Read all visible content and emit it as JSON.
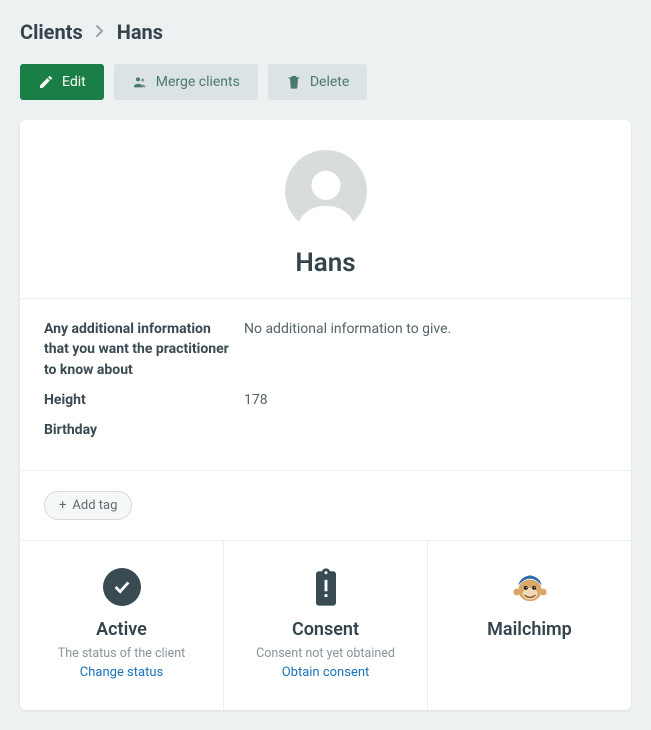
{
  "breadcrumb": {
    "root": "Clients",
    "current": "Hans"
  },
  "actions": {
    "edit": "Edit",
    "merge": "Merge clients",
    "delete": "Delete"
  },
  "profile": {
    "name": "Hans",
    "fields": [
      {
        "label": "Any additional information that you want the practitioner to know about",
        "value": "No additional information to give."
      },
      {
        "label": "Height",
        "value": "178"
      },
      {
        "label": "Birthday",
        "value": ""
      }
    ]
  },
  "tags": {
    "add_label": "Add tag"
  },
  "status": {
    "active": {
      "title": "Active",
      "subtitle": "The status of the client",
      "link": "Change status"
    },
    "consent": {
      "title": "Consent",
      "subtitle": "Consent not yet obtained",
      "link": "Obtain consent"
    },
    "mailchimp": {
      "title": "Mailchimp"
    }
  }
}
